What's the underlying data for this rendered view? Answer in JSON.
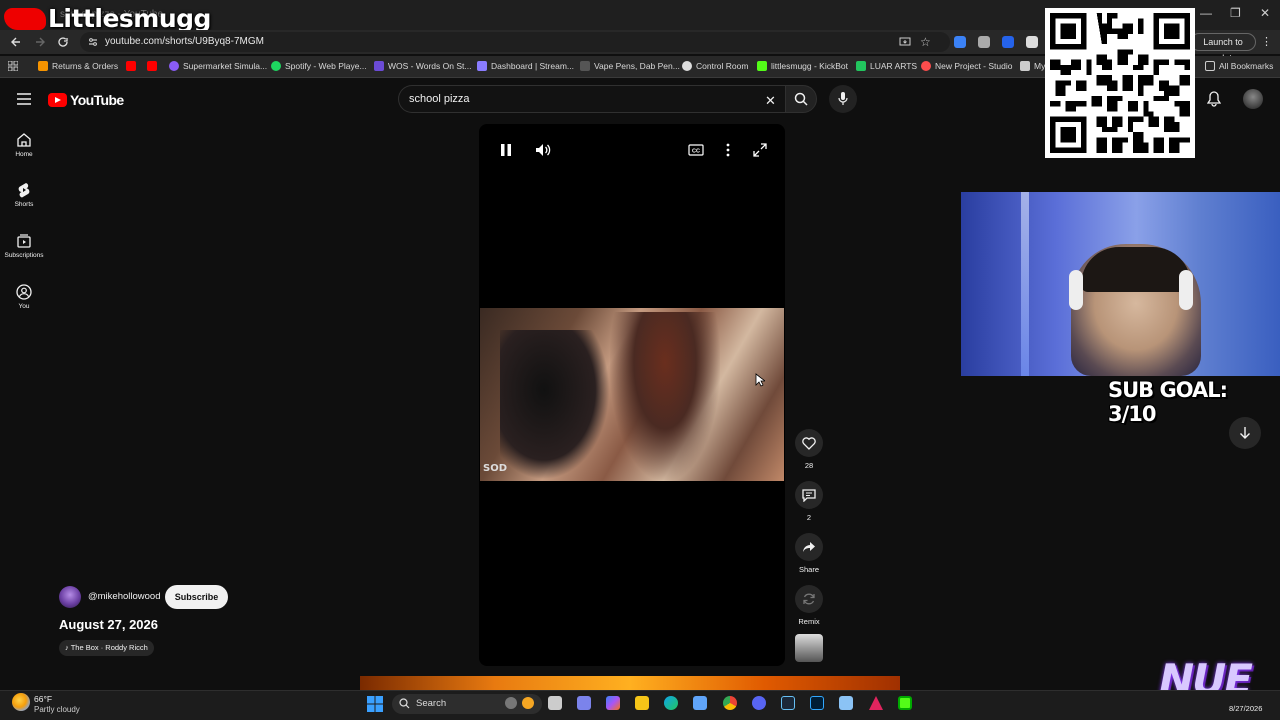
{
  "overlay": {
    "streamer_title": "Littlesmugg",
    "sub_goal": "SUB GOAL: 3/10",
    "logo_text": "NUE"
  },
  "browser": {
    "tab_title_partial": "school pizza - YouTube",
    "url": "youtube.com/shorts/U9Byq8-7MGM",
    "update_label": "Launch to update",
    "bookmarks": [
      {
        "label": "Returns & Orders",
        "color": "#f79400"
      },
      {
        "label": "",
        "color": "#ff0000"
      },
      {
        "label": "",
        "color": "#ff0000"
      },
      {
        "label": "Supermarket Simula...",
        "color": "#8a5cf6"
      },
      {
        "label": "Spotify - Web Playe...",
        "color": "#1ed760"
      },
      {
        "label": "WOS - Words On St...",
        "color": "#6b4bd6"
      },
      {
        "label": "Dashboard | Stream...",
        "color": "#8a7cff"
      },
      {
        "label": "Vape Pens, Dab Pen...",
        "color": "#555"
      },
      {
        "label": "Control Room",
        "color": "#ddd"
      },
      {
        "label": "littlesmugg - KickBot",
        "color": "#53fc18"
      },
      {
        "label": "LUAR ARTS",
        "color": "#22c55e"
      },
      {
        "label": "New Project - Studio",
        "color": "#ff4d4d"
      },
      {
        "label": "My",
        "color": "#ccc"
      }
    ],
    "all_bookmarks": "All Bookmarks"
  },
  "youtube": {
    "logo_label": "YouTube",
    "search_query": "school pizza",
    "sidebar": [
      {
        "label": "Home",
        "icon": "home-icon"
      },
      {
        "label": "Shorts",
        "icon": "shorts-icon"
      },
      {
        "label": "Subscriptions",
        "icon": "subscriptions-icon"
      },
      {
        "label": "You",
        "icon": "you-icon"
      }
    ],
    "video": {
      "watermark": "SOD",
      "channel": "@mikehollowood",
      "subscribe_label": "Subscribe",
      "title": "August 27, 2026",
      "music": "♪ The Box · Roddy Ricch"
    },
    "actions": {
      "like_count": "28",
      "comment_count": "2",
      "share_label": "Share",
      "remix_label": "Remix"
    }
  },
  "taskbar": {
    "weather_temp": "66°F",
    "weather_desc": "Partly cloudy",
    "search_label": "Search",
    "date": "8/27/2026"
  }
}
